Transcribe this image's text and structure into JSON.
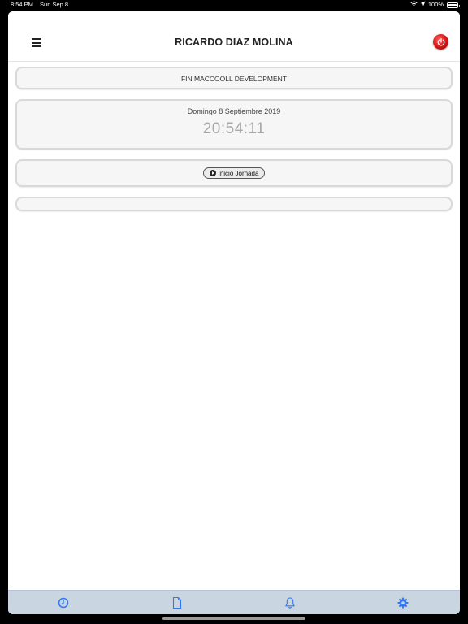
{
  "status_bar": {
    "time": "8:54 PM",
    "date": "Sun Sep 8",
    "battery": "100%",
    "wifi_icon": "wifi-icon",
    "location_icon": "location-arrow-icon",
    "battery_icon": "battery-icon"
  },
  "header": {
    "title": "RICARDO DIAZ MOLINA",
    "menu_icon": "hamburger-menu-icon",
    "power_icon": "power-icon"
  },
  "company": {
    "name": "FIN MACCOOLL DEVELOPMENT"
  },
  "clock": {
    "date": "Domingo 8 Septiembre 2019",
    "time": "20:54:11"
  },
  "actions": {
    "start_label": "Inicio Jornada",
    "start_icon": "play-circle-icon"
  },
  "tab_bar": {
    "tabs": [
      {
        "icon": "clock-icon"
      },
      {
        "icon": "document-icon"
      },
      {
        "icon": "bell-icon"
      },
      {
        "icon": "gear-icon"
      }
    ],
    "active_color": "#3478f6",
    "background": "#cad5e2"
  },
  "colors": {
    "power_red": "#d41515",
    "time_gray": "#a8a8a8"
  }
}
